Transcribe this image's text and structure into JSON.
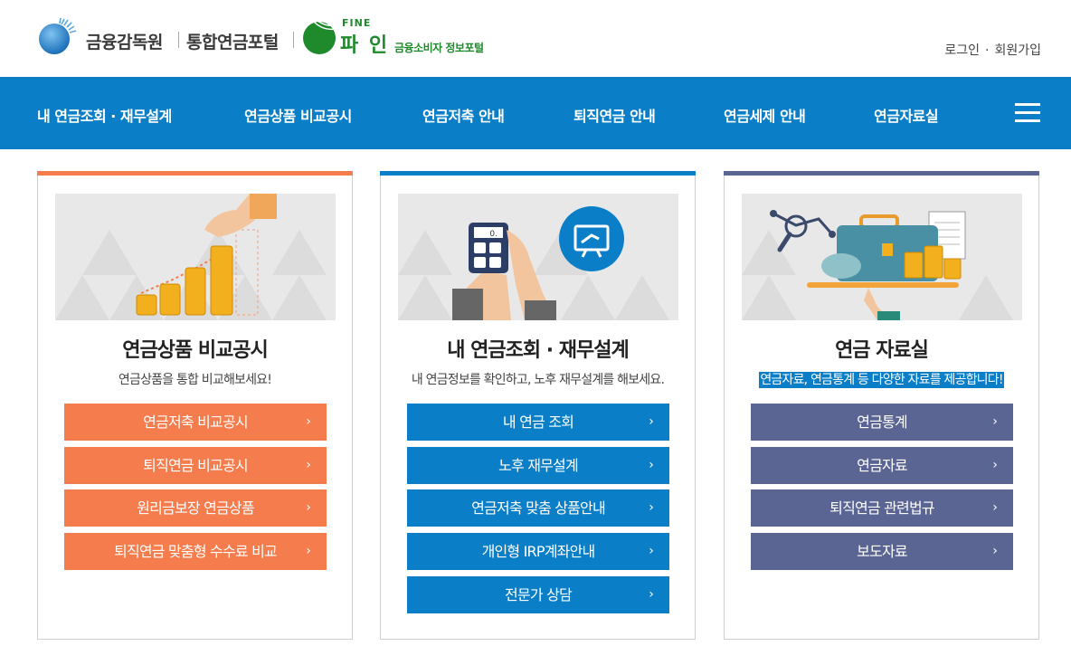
{
  "header": {
    "fss_name": "금융감독원",
    "portal_name": "통합연금포털",
    "fine_small": "FINE",
    "fine_big": "파 인",
    "fine_sub": "금융소비자 정보포털",
    "login": "로그인",
    "separator": "·",
    "signup": "회원가입"
  },
  "nav": {
    "items": [
      "내 연금조회 · 재무설계",
      "연금상품 비교공시",
      "연금저축 안내",
      "퇴직연금 안내",
      "연금세제 안내",
      "연금자료실"
    ],
    "menu_icon": "hamburger-menu-icon"
  },
  "cards": [
    {
      "title": "연금상품 비교공시",
      "desc": "연금상품을 통합 비교해보세요!",
      "color": "#f47c4d",
      "buttons": [
        "연금저축 비교공시",
        "퇴직연금 비교공시",
        "원리금보장 연금상품",
        "퇴직연금 맞춤형 수수료 비교"
      ]
    },
    {
      "title": "내 연금조회 · 재무설계",
      "desc": "내 연금정보를 확인하고, 노후 재무설계를 해보세요.",
      "color": "#0a7fc8",
      "calculator_display": "0.",
      "buttons": [
        "내 연금 조회",
        "노후 재무설계",
        "연금저축 맞춤 상품안내",
        "개인형 IRP계좌안내",
        "전문가 상담"
      ]
    },
    {
      "title": "연금 자료실",
      "desc": "연금자료, 연금통계 등 다양한 자료를 제공합니다!",
      "color": "#5a6593",
      "buttons": [
        "연금통계",
        "연금자료",
        "퇴직연금 관련법규",
        "보도자료"
      ]
    }
  ],
  "arrow_glyph": "›"
}
